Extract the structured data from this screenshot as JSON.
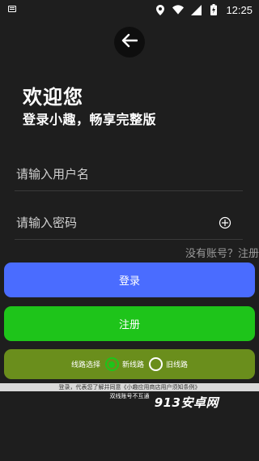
{
  "status_bar": {
    "time": "12:25"
  },
  "header": {
    "welcome": "欢迎您",
    "subtitle": "登录小趣，畅享完整版"
  },
  "form": {
    "username_placeholder": "请输入用户名",
    "password_placeholder": "请输入密码",
    "no_account_text": "没有账号？注册"
  },
  "buttons": {
    "login": "登录",
    "register": "注册"
  },
  "line_select": {
    "label": "线路选择",
    "options": [
      {
        "label": "新线路",
        "selected": true
      },
      {
        "label": "旧线路",
        "selected": false
      }
    ]
  },
  "footer": {
    "agreement": "登录，代表您了解并同意《小趣应用商店用户须知条例》",
    "notice": "双线账号不互通"
  },
  "watermark": "913安卓网",
  "colors": {
    "background": "#1e1e1e",
    "login": "#4a6cff",
    "register": "#1ec41a",
    "line_select": "#6a8e1c"
  }
}
